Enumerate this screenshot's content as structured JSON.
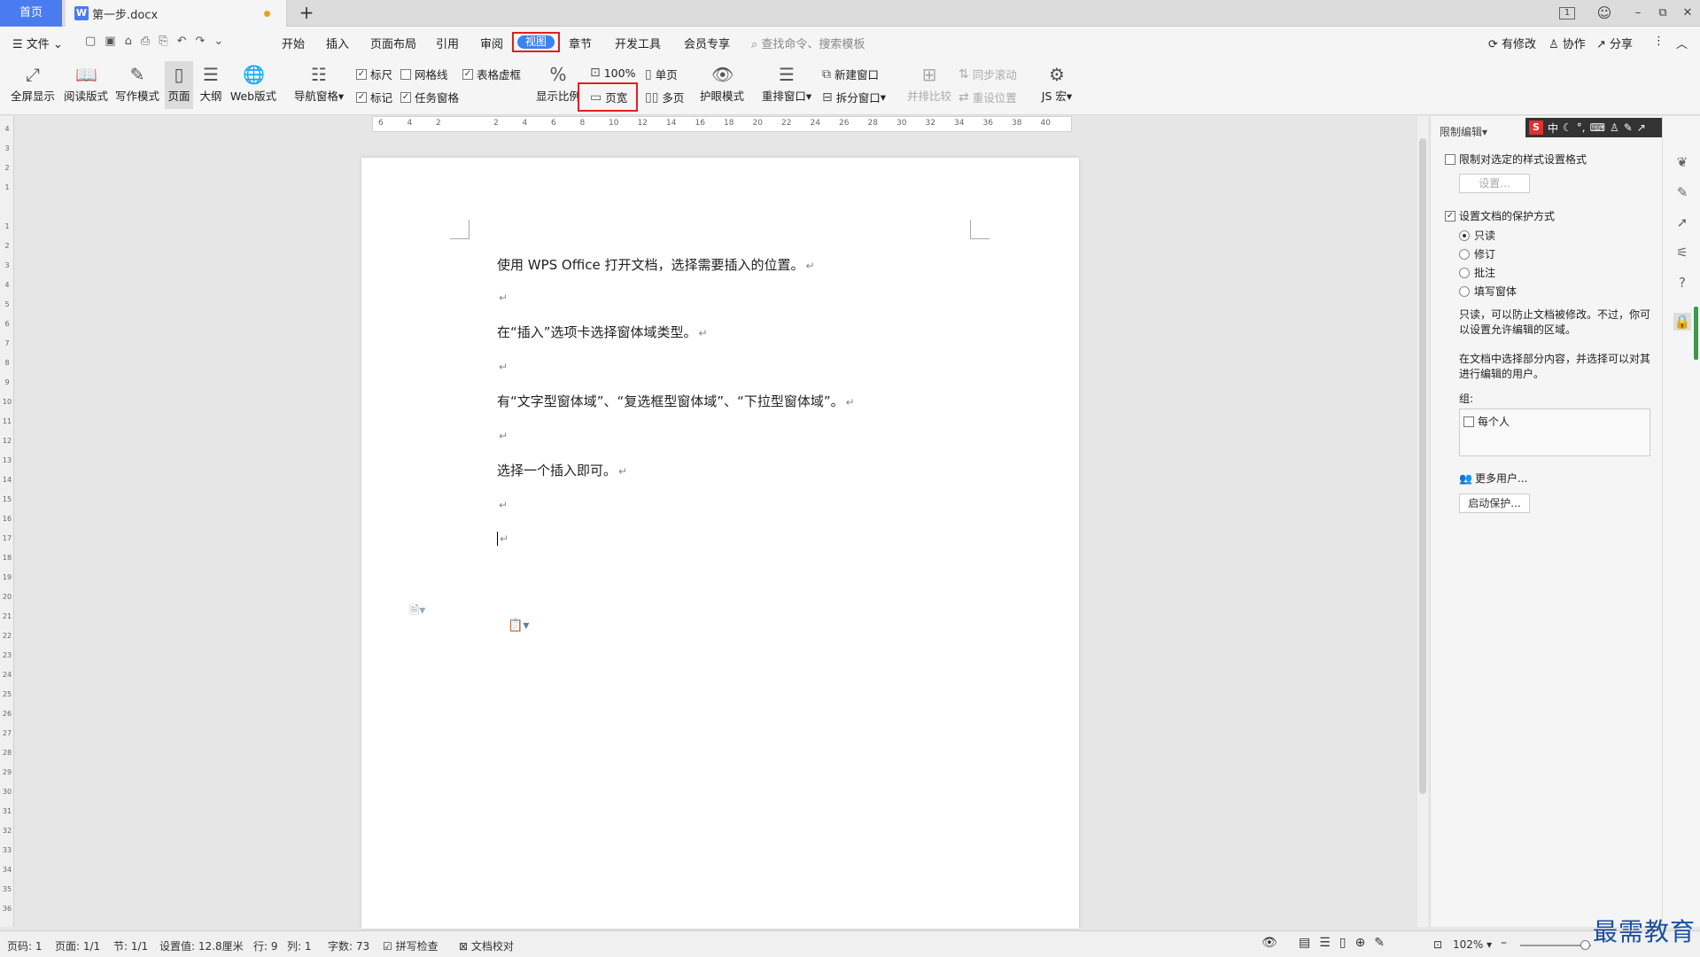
{
  "tabs": {
    "home": "首页",
    "doc": "第一步.docx",
    "new": "+"
  },
  "window": {
    "badge": "1",
    "min": "–",
    "max": "⧉",
    "close": "✕"
  },
  "menu": {
    "file": "文件",
    "items": [
      "开始",
      "插入",
      "页面布局",
      "引用",
      "审阅",
      "视图",
      "章节",
      "开发工具",
      "会员专享"
    ],
    "search_placeholder": "查找命令、搜索模板",
    "modified": "有修改",
    "collab": "协作",
    "share": "分享"
  },
  "ribbon": {
    "fullscreen": "全屏显示",
    "reading": "阅读版式",
    "writing": "写作模式",
    "page": "页面",
    "outline": "大纲",
    "web": "Web版式",
    "nav_pane": "导航窗格",
    "ruler": "标尺",
    "gridlines": "网格线",
    "table_frame": "表格虚框",
    "marks": "标记",
    "task_pane": "任务窗格",
    "zoom_ratio": "显示比例",
    "zoom_100": "100%",
    "page_width": "页宽",
    "single_page": "单页",
    "multi_page": "多页",
    "eye_mode": "护眼模式",
    "rearrange": "重排窗口",
    "new_window": "新建窗口",
    "split_window": "拆分窗口",
    "side_by_side": "并排比较",
    "sync_scroll": "同步滚动",
    "reset_pos": "重设位置",
    "js_macro": "JS 宏"
  },
  "document": {
    "paragraphs": [
      "使用 WPS Office 打开文档，选择需要插入的位置。",
      "",
      "在“插入”选项卡选择窗体域类型。",
      "",
      "有“文字型窗体域”、“复选框型窗体域”、“下拉型窗体域”。",
      "",
      "选择一个插入即可。",
      "",
      ""
    ],
    "para_mark": "↵"
  },
  "ruler_ticks": [
    "6",
    "4",
    "2",
    "",
    "2",
    "4",
    "6",
    "8",
    "10",
    "12",
    "14",
    "16",
    "18",
    "20",
    "22",
    "24",
    "26",
    "28",
    "30",
    "32",
    "34",
    "36",
    "38",
    "40"
  ],
  "vruler_ticks": [
    "4",
    "3",
    "2",
    "1",
    "",
    "1",
    "2",
    "3",
    "4",
    "5",
    "6",
    "7",
    "8",
    "9",
    "10",
    "11",
    "12",
    "13",
    "14",
    "15",
    "16",
    "17",
    "18",
    "19",
    "20",
    "21",
    "22",
    "23",
    "24",
    "25",
    "26",
    "27",
    "28",
    "29",
    "30",
    "31",
    "32",
    "33",
    "34",
    "35",
    "36"
  ],
  "pane": {
    "title": "限制编辑",
    "restrict_format": "限制对选定的样式设置格式",
    "settings_btn": "设置...",
    "protect_mode": "设置文档的保护方式",
    "options": [
      "只读",
      "修订",
      "批注",
      "填写窗体"
    ],
    "desc1": "只读，可以防止文档被修改。不过，你可以设置允许编辑的区域。",
    "desc2": "在文档中选择部分内容，并选择可以对其进行编辑的用户。",
    "group_label": "组:",
    "everyone": "每个人",
    "more_users": "更多用户...",
    "start_protect": "启动保护..."
  },
  "ime": {
    "s": "S",
    "lang": "中"
  },
  "status": {
    "page_code": "页码: 1",
    "pages": "页面: 1/1",
    "section": "节: 1/1",
    "setting": "设置值: 12.8厘米",
    "row": "行: 9",
    "col": "列: 1",
    "words": "字数: 73",
    "spell": "拼写检查",
    "proof": "文档校对",
    "zoom": "102%"
  },
  "watermark": "最需教育",
  "colors": {
    "accent": "#3b82f0",
    "highlight": "#e02020"
  }
}
